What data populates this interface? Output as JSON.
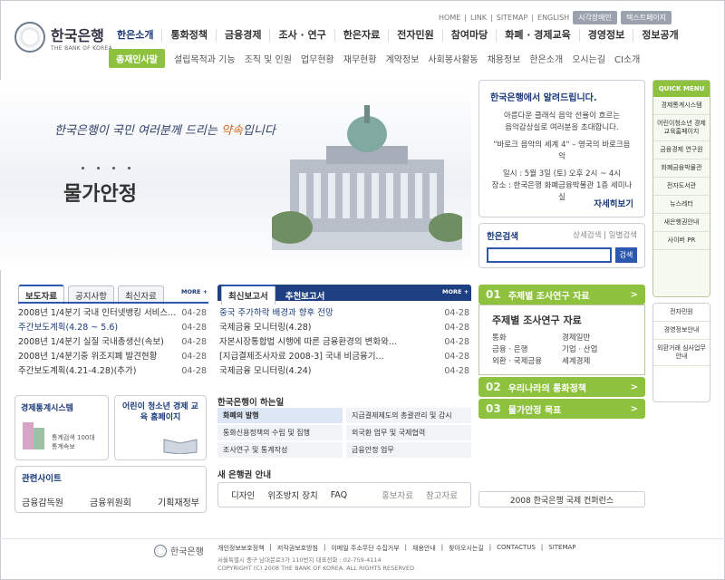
{
  "utility_links": [
    "HOME",
    "LINK",
    "SITEMAP",
    "ENGLISH"
  ],
  "utility_buttons": [
    "시각장애인",
    "텍스트페이지"
  ],
  "logo": {
    "korean": "한국은행",
    "english": "THE BANK OF KOREA"
  },
  "gnb": [
    "한은소개",
    "통화정책",
    "금융경제",
    "조사 · 연구",
    "한은자료",
    "전자민원",
    "참여마당",
    "화폐 · 경제교육",
    "경영정보",
    "정보공개"
  ],
  "subnav": [
    "총재인사말",
    "설립목적과 기능",
    "조직 및 인원",
    "업무현황",
    "재무현황",
    "계약정보",
    "사회봉사활동",
    "채용정보",
    "한은소개",
    "오시는길",
    "CI소개"
  ],
  "banner": {
    "script_before": "한국은행이 국민 여러분께 드리는 ",
    "script_highlight": "약속",
    "script_after": "입니다",
    "title": "물가안정"
  },
  "notice": {
    "title": "한국은행에서 알려드립니다.",
    "lines": [
      "아름다운 클래식 음악 선율이 흐르는",
      "음악감상실로 여러분을 초대합니다.",
      "\"바로크 음악의 세계 4\" – 영국의 바로크음악",
      "일시 : 5월 3일 (토) 오후 2시 ~ 4시",
      "장소 : 한국은행 화폐금융박물관 1층 세미나실"
    ],
    "more": "자세히보기"
  },
  "search": {
    "title": "한은검색",
    "options": "상세검색 | 일별검색",
    "button": "검색",
    "placeholder": ""
  },
  "quick_menu": {
    "head": "QUICK MENU",
    "items": [
      "경제통계시스템",
      "어린이청소년 경제교육홈페이지",
      "금융경제 연구원",
      "화폐금융박물관",
      "전자도서관",
      "뉴스레터",
      "새은행권안내",
      "사이버 PR"
    ],
    "items2": [
      "전자민원",
      "경영정보안내",
      "외환거래 심사업무안내"
    ]
  },
  "news": {
    "tabs": [
      "보도자료",
      "공지사항",
      "최신자료"
    ],
    "more": "MORE +",
    "rows": [
      {
        "title": "2008년 1/4분기 국내 인터넷뱅킹 서비스...",
        "date": "04-28"
      },
      {
        "title": "주간보도계획(4.28 ~ 5.6)",
        "date": "04-28"
      },
      {
        "title": "2008년 1/4분기 실질 국내총생산(속보)",
        "date": "04-28"
      },
      {
        "title": "2008년 1/4분기중 위조지폐 발견현황",
        "date": "04-28"
      },
      {
        "title": "주간보도계획(4.21-4.28)(추가)",
        "date": "04-28"
      }
    ]
  },
  "reports": {
    "tabs": [
      "최신보고서",
      "추천보고서"
    ],
    "more": "MORE +",
    "rows": [
      {
        "title": "중국 주가하락 배경과 향후 전망",
        "date": "04-28"
      },
      {
        "title": "국제금융 모니터링(4.28)",
        "date": "04-28"
      },
      {
        "title": "자본시장통합법 시행에 따른 금융환경의 변화와...",
        "date": "04-28"
      },
      {
        "title": "[지급결제조사자료 2008-3] 국내 비금융기...",
        "date": "04-28"
      },
      {
        "title": "국제금융 모니터링(4.24)",
        "date": "04-28"
      }
    ]
  },
  "promos": [
    {
      "title": "경제통계시스템",
      "caption": "통계검색 100대 통계속보"
    },
    {
      "title": "어린이 청소년 경제 교육 홈페이지",
      "caption": ""
    }
  ],
  "related": {
    "title": "관련사이트",
    "items": [
      "금융감독원",
      "금융위원회",
      "기획재정부"
    ]
  },
  "role": {
    "title": "한국은행이 하는일",
    "items": [
      "화폐의 발행",
      "지급결제제도의 총괄관리 및 감시",
      "통화신용정책의 수립 및 집행",
      "외국환 업무 및 국제협력",
      "조사연구 및 통계작성",
      "금융안정 업무"
    ]
  },
  "new_note": {
    "title": "새 은행권 안내",
    "items": [
      "디자인",
      "위조방지 장치",
      "FAQ"
    ],
    "right": [
      "홍보자료",
      "참고자료"
    ]
  },
  "accordion": {
    "items": [
      {
        "num": "01",
        "label": "주제별 조사연구 자료"
      },
      {
        "num": "02",
        "label": "우리나라의 통화정책"
      },
      {
        "num": "03",
        "label": "물가안정 목표"
      }
    ],
    "body_title": "주제별 조사연구 자료",
    "body_items": [
      "통화",
      "경제일반",
      "금융 · 은행",
      "기업 · 산업",
      "외환 · 국제금융",
      "세계경제"
    ]
  },
  "conference": "2008 한국은행 국제 컨퍼런스",
  "footer": {
    "logo": "한국은행",
    "links": [
      "개인정보보호정책",
      "저작권보호방침",
      "이메일 주소무단 수집거부",
      "채용안내",
      "찾아오시는길",
      "CONTACTUS",
      "SITEMAP"
    ],
    "address": "서울특별시 중구 남대문로3가 110번지 대표전화 : 02-759-4114",
    "copyright": "COPYRIGHT (C) 2008 THE BANK OF KOREA. ALL RIGHTS RESERVED"
  },
  "colors": {
    "brand_blue": "#1e3f82",
    "accent_green": "#8ec23e",
    "highlight_orange": "#d46a1e"
  }
}
